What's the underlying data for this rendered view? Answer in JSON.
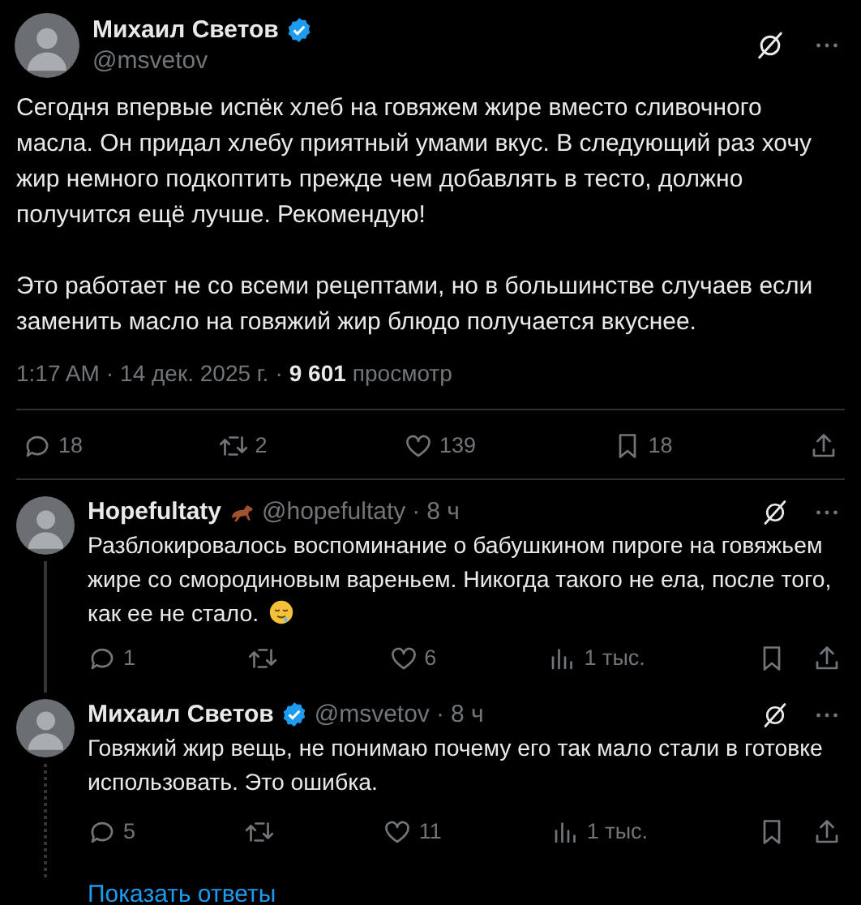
{
  "post": {
    "author": "Михаил Светов",
    "verified": true,
    "handle": "@msvetov",
    "paragraphs": [
      "Сегодня впервые испёк хлеб на говяжем жире вместо сливочного масла. Он придал хлебу приятный умами вкус. В следующий раз хочу жир немного подкоптить прежде чем добавлять в тесто, должно получится ещё лучше. Рекомендую!",
      "Это работает не со всеми рецептами, но в большинстве случаев если заменить масло на говяжий жир блюдо получается вкуснее."
    ],
    "time": "1:17 AM",
    "separators": [
      "·",
      "·"
    ],
    "date": "14 дек. 2025 г.",
    "views": "9 601",
    "views_label": "просмотр",
    "stats": {
      "replies": "18",
      "reposts": "2",
      "likes": "139",
      "bookmarks": "18"
    }
  },
  "replies": [
    {
      "author": "Hopefultaty",
      "verified": false,
      "name_emoji": true,
      "handle": "@hopefultaty",
      "separator": "·",
      "age": "8 ч",
      "text": "Разблокировалось воспоминание о бабушкином пироге на говяжьем жире со смородиновым вареньем. Никогда такого не ела, после того, как ее не стало.",
      "text_emoji": true,
      "stats": {
        "replies": "1",
        "likes": "6",
        "views": "1 тыс."
      }
    },
    {
      "author": "Михаил Светов",
      "verified": true,
      "name_emoji": false,
      "handle": "@msvetov",
      "separator": "·",
      "age": "8 ч",
      "text": "Говяжий жир вещь, не понимаю почему его так мало стали в готовке использовать. Это ошибка.",
      "text_emoji": false,
      "stats": {
        "replies": "5",
        "likes": "11",
        "views": "1 тыс."
      }
    }
  ],
  "show_replies": "Показать ответы"
}
